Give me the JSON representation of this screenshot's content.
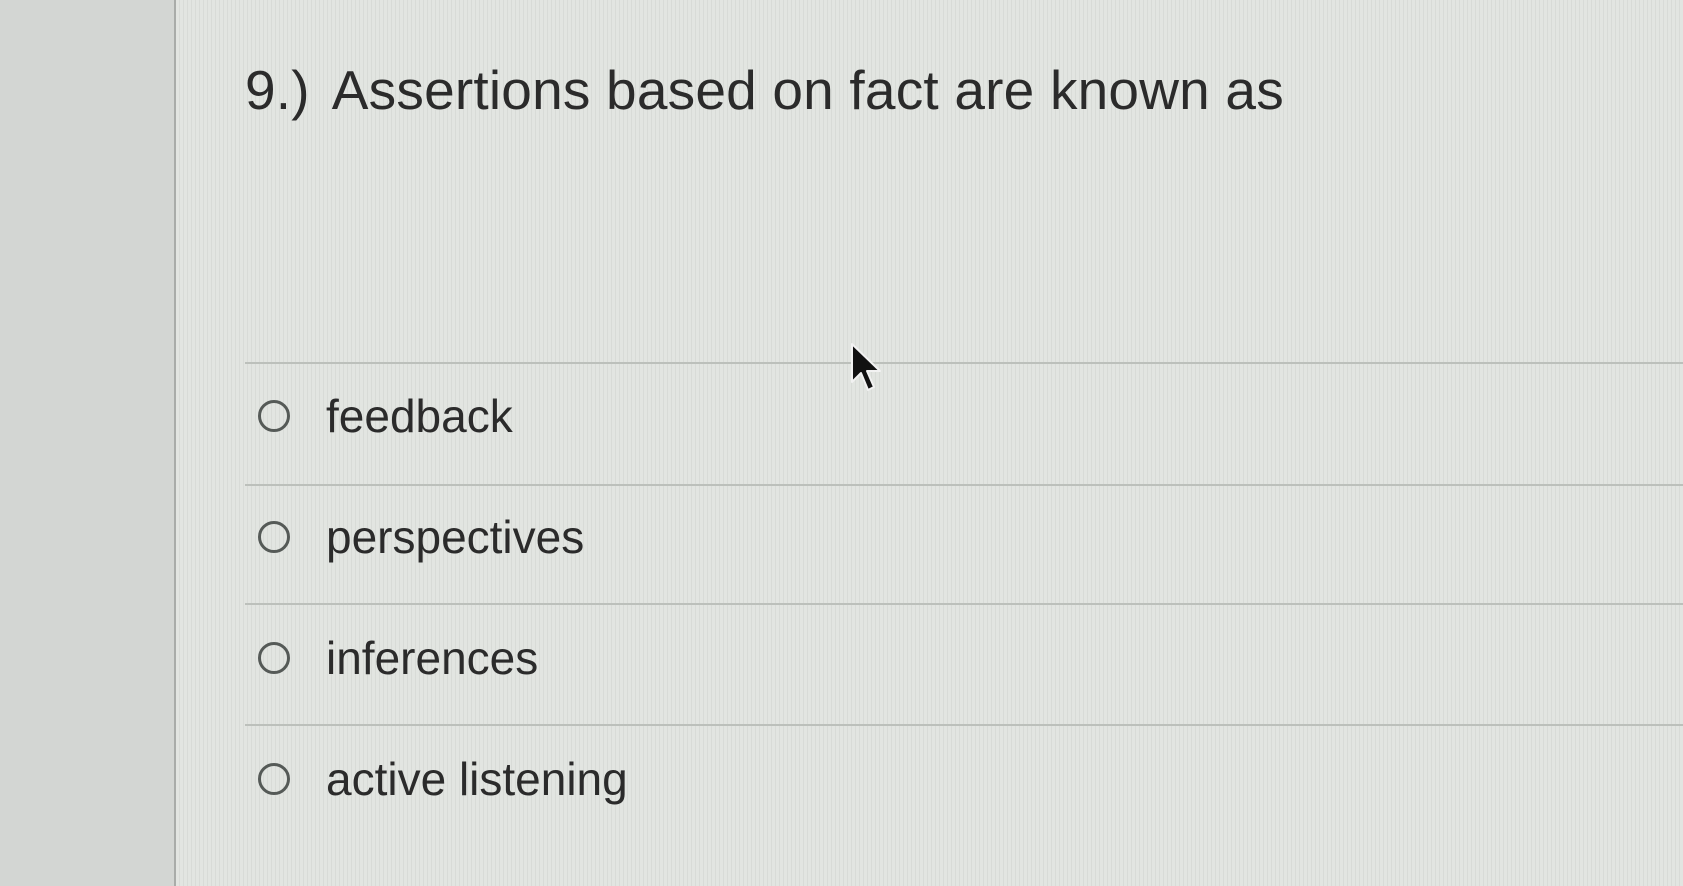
{
  "question": {
    "number": "9.)",
    "text": "Assertions based on fact are known as"
  },
  "options": [
    {
      "label": "feedback",
      "selected": false
    },
    {
      "label": "perspectives",
      "selected": false
    },
    {
      "label": "inferences",
      "selected": false
    },
    {
      "label": "active listening",
      "selected": false
    }
  ],
  "icons": {
    "cursor": "mouse-pointer-icon",
    "radio": "radio-unselected-icon"
  }
}
